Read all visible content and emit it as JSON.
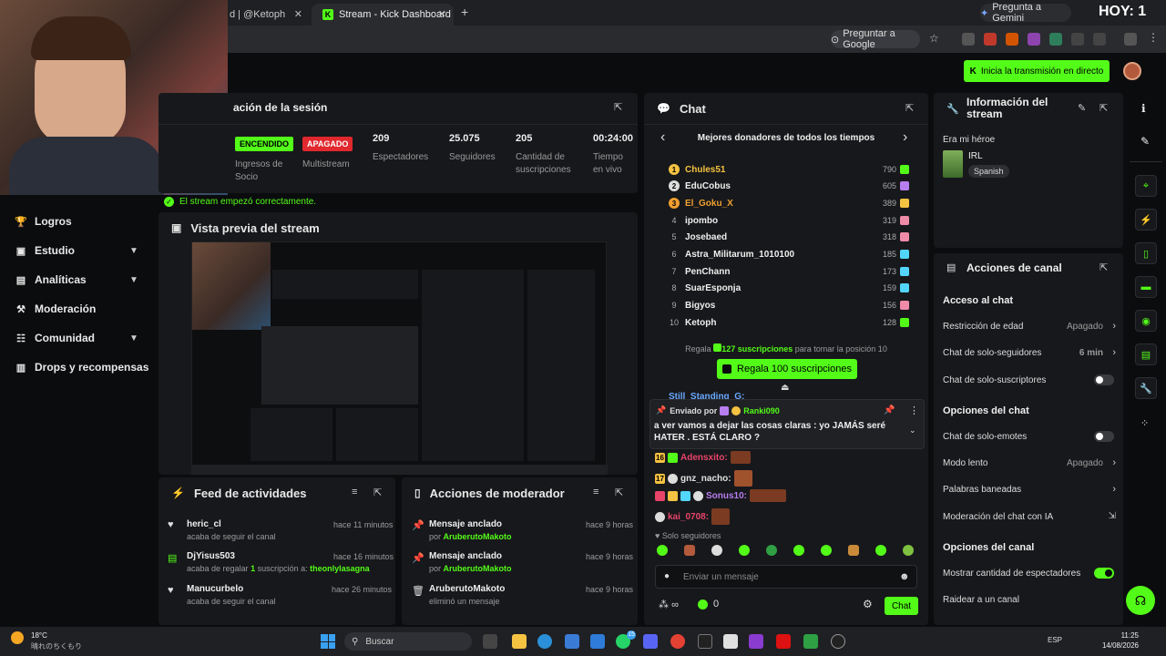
{
  "browser": {
    "tabs": [
      {
        "label": "d | @Ketoph"
      },
      {
        "label": "Stream - Kick Dashboard"
      }
    ],
    "new_tab": "+",
    "gemini": "Pregunta a Gemini",
    "overlay_title": "HOY: 1",
    "ask_google": "Preguntar a Google"
  },
  "header": {
    "start_stream": "Inicia la transmisión en directo"
  },
  "sidebar": {
    "items": [
      {
        "label": "Logros",
        "icon": "trophy-icon"
      },
      {
        "label": "Estudio",
        "icon": "studio-icon"
      },
      {
        "label": "Analíticas",
        "icon": "analytics-icon"
      },
      {
        "label": "Moderación",
        "icon": "hammer-icon"
      },
      {
        "label": "Comunidad",
        "icon": "community-icon"
      },
      {
        "label": "Drops y recompensas",
        "icon": "drops-icon"
      }
    ]
  },
  "session": {
    "title": "ación de la sesión",
    "stats": [
      {
        "badge": "ENCENDIDO",
        "label": "Ingresos de Socio"
      },
      {
        "badge": "APAGADO",
        "label": "Multistream"
      },
      {
        "value": "209",
        "label": "Espectadores"
      },
      {
        "value": "25.075",
        "label": "Seguidores"
      },
      {
        "value": "205",
        "label": "Cantidad de suscripciones"
      },
      {
        "value": "00:24:00",
        "label": "Tiempo en vivo"
      }
    ],
    "status": "El stream empezó correctamente."
  },
  "preview": {
    "title": "Vista previa del stream"
  },
  "feed": {
    "title": "Feed de actividades",
    "items": [
      {
        "user": "heric_cl",
        "desc": "acaba de seguir el canal",
        "time": "hace 11 minutos"
      },
      {
        "user": "DjYisus503",
        "desc_pre": "acaba de regalar ",
        "count": "1",
        "desc_mid": " suscripción a: ",
        "target": "theonlylasagna",
        "time": "hace 16 minutos"
      },
      {
        "user": "Manucurbelo",
        "desc": "acaba de seguir el canal",
        "time": "hace 26 minutos"
      }
    ]
  },
  "modactions": {
    "title": "Acciones de moderador",
    "items": [
      {
        "title": "Mensaje anclado",
        "by_pre": "por ",
        "by": "AruberutoMakoto",
        "time": "hace 9 horas"
      },
      {
        "title": "Mensaje anclado",
        "by_pre": "por ",
        "by": "AruberutoMakoto",
        "time": "hace 9 horas"
      },
      {
        "title": "AruberutoMakoto",
        "desc": "eliminó un mensaje",
        "time": "hace 9 horas"
      }
    ]
  },
  "chat": {
    "title": "Chat",
    "donors_title": "Mejores donadores de todos los tiempos",
    "donors": [
      {
        "rank": "1",
        "name": "Chules51",
        "amount": "790",
        "color": "#f5c242"
      },
      {
        "rank": "2",
        "name": "EduCobus",
        "amount": "605",
        "color": "#eeeeee"
      },
      {
        "rank": "3",
        "name": "El_Goku_X",
        "amount": "389",
        "color": "#f0a030"
      },
      {
        "rank": "4",
        "name": "ipombo",
        "amount": "319",
        "color": "#eeeeee"
      },
      {
        "rank": "5",
        "name": "Josebaed",
        "amount": "318",
        "color": "#eeeeee"
      },
      {
        "rank": "6",
        "name": "Astra_Militarum_1010100",
        "amount": "185",
        "color": "#eeeeee"
      },
      {
        "rank": "7",
        "name": "PenChann",
        "amount": "173",
        "color": "#eeeeee"
      },
      {
        "rank": "8",
        "name": "SuarEsponja",
        "amount": "159",
        "color": "#eeeeee"
      },
      {
        "rank": "9",
        "name": "Bigyos",
        "amount": "156",
        "color": "#eeeeee"
      },
      {
        "rank": "10",
        "name": "Ketoph",
        "amount": "128",
        "color": "#eeeeee"
      }
    ],
    "gift_pre": "Regala",
    "gift_count": "127 suscripciones",
    "gift_post": "para tomar la posición 10",
    "gift_button": "Regala 100 suscripciones",
    "prev_user": "Still_Standing_G:",
    "pinned_by": "Enviado por",
    "pinned_user": "Ranki090",
    "pinned_text": "a ver vamos a dejar las cosas claras : yo JAMÁS seré HATER . ESTÁ CLARO ?",
    "messages": [
      {
        "badge": "16",
        "user": "Adensxito:",
        "color": "#e8446a"
      },
      {
        "badge": "17",
        "user": "gnz_nacho:",
        "color": "#e0e0e0"
      },
      {
        "badge": "",
        "user": "Sonus10:",
        "color": "#b77ef0"
      },
      {
        "badge": "",
        "user": "kai_0708:",
        "color": "#e8446a"
      }
    ],
    "followers_only": "Solo seguidores",
    "input_placeholder": "Enviar un mensaje",
    "infinite": "∞",
    "points": "0",
    "send": "Chat"
  },
  "info": {
    "title": "Información del stream",
    "stream_title": "Era mi héroe",
    "category": "IRL",
    "language": "Spanish"
  },
  "channel": {
    "title": "Acciones de canal",
    "chat_access": "Acceso al chat",
    "age_restriction": "Restricción de edad",
    "age_restriction_value": "Apagado",
    "followers_chat": "Chat de solo-seguidores",
    "followers_chat_value": "6 min",
    "subs_chat": "Chat de solo-suscriptores",
    "chat_options": "Opciones del chat",
    "emote_chat": "Chat de solo-emotes",
    "slow_mode": "Modo lento",
    "slow_mode_value": "Apagado",
    "banned_words": "Palabras baneadas",
    "ai_moderation": "Moderación del chat con IA",
    "channel_options": "Opciones del canal",
    "show_viewers": "Mostrar cantidad de espectadores",
    "raid": "Raidear a un canal"
  },
  "taskbar": {
    "weather_temp": "18°C",
    "weather_desc": "晴れのちくもり",
    "search": "Buscar",
    "lang": "ESP",
    "time": "11:25",
    "date": "14/08/2026",
    "notif_count": "15"
  },
  "colors": {
    "accent": "#53fc18",
    "red": "#e0282e",
    "panel": "#17181b",
    "background": "#0b0c0e"
  }
}
